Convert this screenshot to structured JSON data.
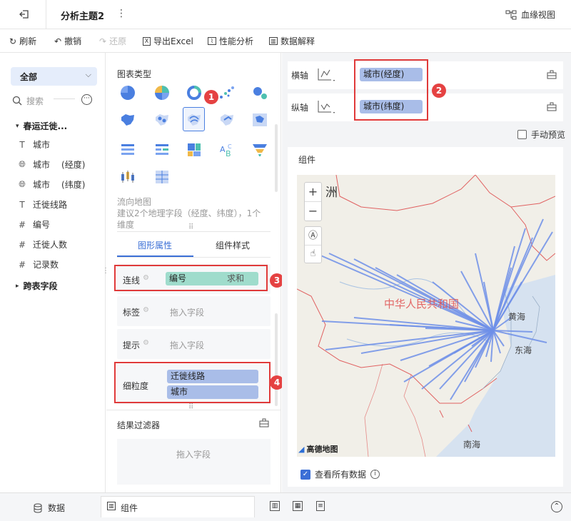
{
  "header": {
    "title": "分析主题2",
    "lineage": "血缘视图"
  },
  "toolbar": {
    "refresh": "刷新",
    "undo": "撤销",
    "redo": "还原",
    "export": "导出Excel",
    "perf": "性能分析",
    "explain": "数据解释"
  },
  "left": {
    "selector": "全部",
    "search_placeholder": "搜索",
    "table_name": "春运迁徙...",
    "fields": [
      {
        "icon": "T",
        "name": "城市",
        "sub": ""
      },
      {
        "icon": "globe",
        "name": "城市",
        "sub": "(经度)"
      },
      {
        "icon": "globe",
        "name": "城市",
        "sub": "(纬度)"
      },
      {
        "icon": "T",
        "name": "迁徙线路",
        "sub": ""
      },
      {
        "icon": "#",
        "name": "编号",
        "sub": ""
      },
      {
        "icon": "#",
        "name": "迁徙人数",
        "sub": ""
      },
      {
        "icon": "#",
        "name": "记录数",
        "sub": ""
      }
    ],
    "cross_table": "跨表字段"
  },
  "mid": {
    "chart_type_title": "图表类型",
    "desc_line1": "流向地图",
    "desc_line2": "建议2个地理字段（经度、纬度），1个",
    "desc_line3": "维度",
    "tab_props": "图形属性",
    "tab_style": "组件样式",
    "line_label": "连线",
    "line_field": "编号",
    "line_agg": "求和",
    "label_label": "标签",
    "label_ph": "拖入字段",
    "tip_label": "提示",
    "tip_ph": "拖入字段",
    "grain_label": "细粒度",
    "grain_fields": [
      "迁徙线路",
      "城市"
    ],
    "filter_title": "结果过滤器",
    "filter_ph": "拖入字段"
  },
  "right": {
    "x_axis_label": "横轴",
    "x_field": "城市(经度)",
    "y_axis_label": "纵轴",
    "y_field": "城市(纬度)",
    "manual_preview": "手动预览",
    "component_title": "组件",
    "map_labels": {
      "continent": "洲",
      "country": "中华人民共和国",
      "yellow_sea": "黄海",
      "east_sea": "东海",
      "south_sea": "南海"
    },
    "map_logo": "高德地图",
    "view_all": "查看所有数据",
    "zoom_in": "+",
    "zoom_out": "−"
  },
  "bottom": {
    "data_tab": "数据",
    "component_tab": "组件"
  },
  "badges": [
    "1",
    "2",
    "3",
    "4"
  ],
  "colors": {
    "accent": "#3b6fd6",
    "red": "#e03a3a",
    "flow": "#6f8fe8",
    "pill_blue": "#a9bde8",
    "pill_teal": "#9fdccc"
  }
}
